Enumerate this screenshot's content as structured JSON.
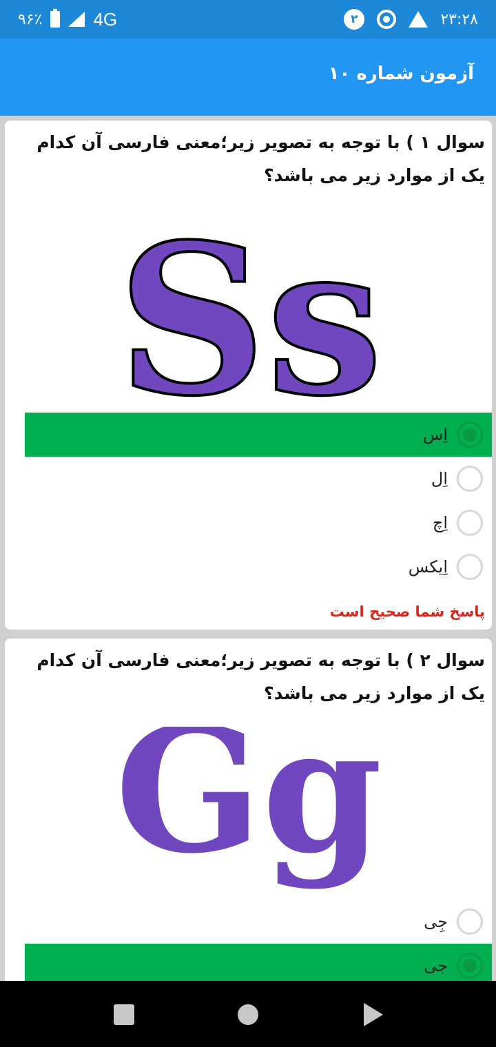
{
  "status_bar": {
    "battery_text": "۹۶٪",
    "network": "4G",
    "notification_count": "۲",
    "time": "۲۳:۲۸"
  },
  "app_bar": {
    "title": "آزمون شماره ۱۰"
  },
  "questions": [
    {
      "text": "سوال ۱ ) با توجه به تصویر زیر؛معنی فارسی آن کدام یک از موارد زیر می باشد؟",
      "image_letters": "Ss",
      "options": [
        {
          "label": "اِس",
          "state": "correct"
        },
        {
          "label": "اِل",
          "state": "unselected"
        },
        {
          "label": "اِچ",
          "state": "unselected"
        },
        {
          "label": "اِیکس",
          "state": "unselected"
        }
      ],
      "result": "پاسخ شما صحیح است"
    },
    {
      "text": "سوال ۲ ) با توجه به تصویر زیر؛معنی فارسی آن کدام یک از موارد زیر می باشد؟",
      "image_letters": "Gg",
      "options": [
        {
          "label": "جِی",
          "state": "unselected"
        },
        {
          "label": "جی",
          "state": "correct"
        }
      ]
    }
  ],
  "colors": {
    "status_bar": "#1e88d8",
    "app_bar": "#2196f3",
    "correct_option": "#00b050",
    "result_text": "#d9261c",
    "letter_purple": "#7047be"
  }
}
